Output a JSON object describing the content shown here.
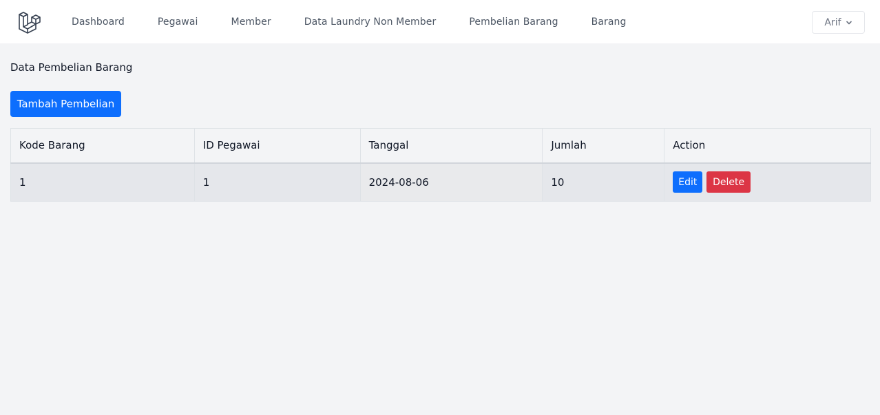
{
  "nav": {
    "logo_icon": "laravel-logo-icon",
    "items": [
      {
        "label": "Dashboard"
      },
      {
        "label": "Pegawai"
      },
      {
        "label": "Member"
      },
      {
        "label": "Data Laundry Non Member"
      },
      {
        "label": "Pembelian Barang"
      },
      {
        "label": "Barang"
      }
    ],
    "user": {
      "name": "Arif",
      "icon": "chevron-down-icon"
    }
  },
  "main": {
    "title": "Data Pembelian Barang",
    "add_button_label": "Tambah Pembelian",
    "table": {
      "headers": [
        "Kode Barang",
        "ID Pegawai",
        "Tanggal",
        "Jumlah",
        "Action"
      ],
      "rows": [
        {
          "kode_barang": "1",
          "id_pegawai": "1",
          "tanggal": "2024-08-06",
          "jumlah": "10",
          "edit_label": "Edit",
          "delete_label": "Delete"
        }
      ]
    }
  },
  "colors": {
    "primary": "#0d6efd",
    "danger": "#dc3545",
    "background": "#f3f4f6",
    "navbar": "#ffffff"
  }
}
